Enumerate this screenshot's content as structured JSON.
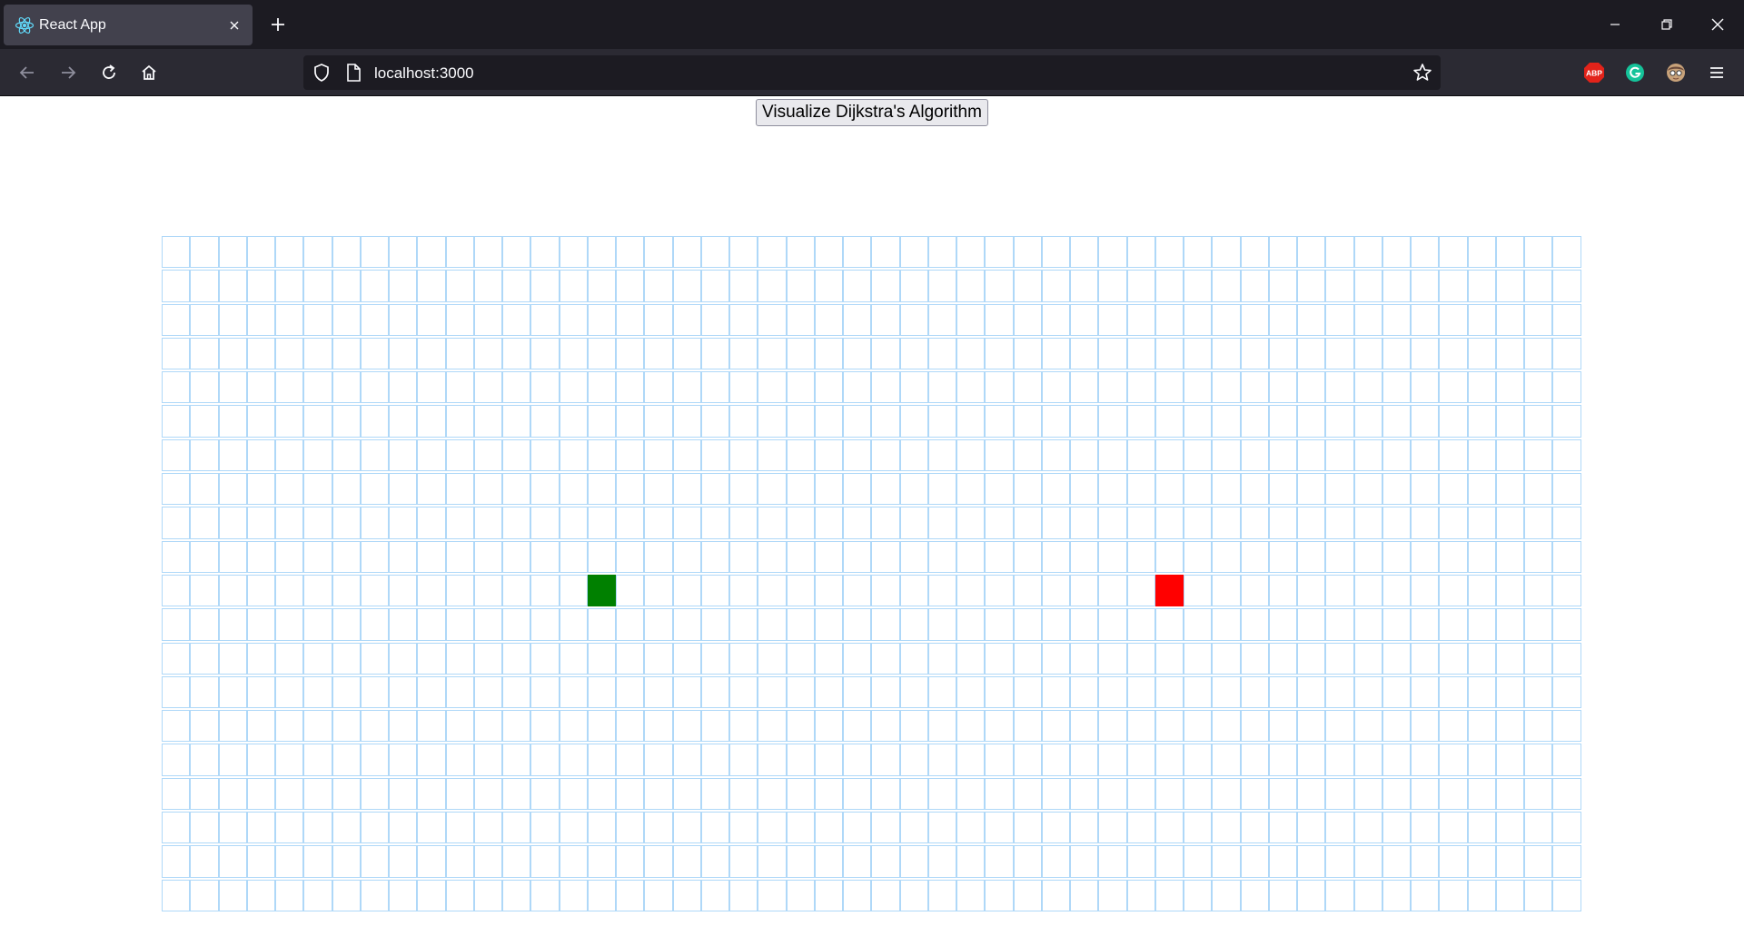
{
  "browser": {
    "tab": {
      "title": "React App",
      "favicon": "react-logo-icon"
    },
    "new_tab_icon": "plus-icon",
    "window_controls": [
      "minimize-icon",
      "restore-icon",
      "close-icon"
    ],
    "nav": [
      "back-arrow-icon",
      "forward-arrow-icon",
      "reload-icon",
      "home-icon"
    ],
    "url": "localhost:3000",
    "extensions": [
      {
        "name": "adblock-plus-icon",
        "label": "ABP",
        "color": "#e2231a"
      },
      {
        "name": "grammarly-icon",
        "label": "G",
        "color": "#15c39a"
      },
      {
        "name": "avatar-icon",
        "label": "",
        "color": "#b08060"
      }
    ],
    "menu_icon": "hamburger-menu-icon"
  },
  "page": {
    "button_label": "Visualize Dijkstra's Algorithm",
    "grid": {
      "rows": 20,
      "cols": 50,
      "start": {
        "row": 10,
        "col": 15
      },
      "finish": {
        "row": 10,
        "col": 35
      },
      "colors": {
        "cell_border": "#afd8f8",
        "start": "#008000",
        "finish": "#ff0000"
      }
    }
  }
}
